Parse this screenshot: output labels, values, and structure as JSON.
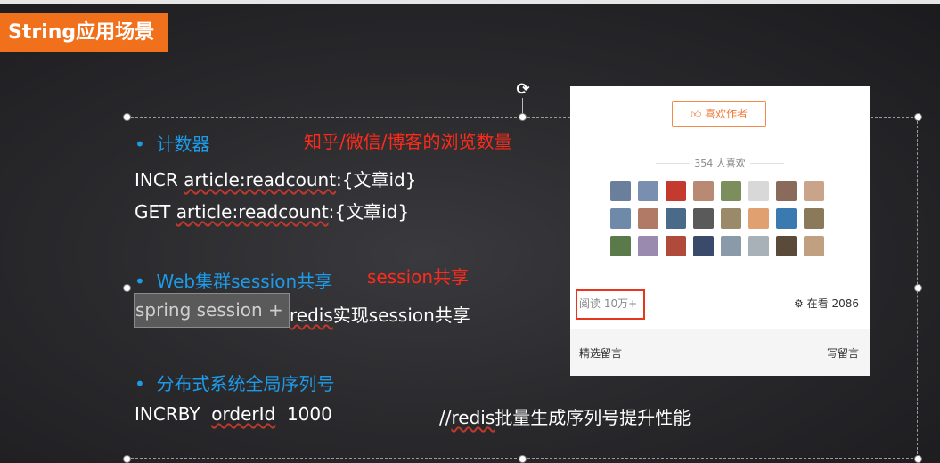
{
  "slide": {
    "title": "String应用场景",
    "rotate_icon": "rotate-icon"
  },
  "content": {
    "counter_heading": "计数器",
    "counter_note": "知乎/微信/博客的浏览数量",
    "incr_cmd": "INCR",
    "incr_key": "article:readcount",
    "incr_suffix": ":{文章id}",
    "get_cmd": "GET",
    "get_key": "article:readcount",
    "get_suffix": ":{文章id}",
    "web_heading": "Web集群session共享",
    "web_note": "session共享",
    "spring_text": "spring session + ",
    "redis_word": "redis",
    "redis_suffix": "实现session共享",
    "dist_heading": "分布式系统全局序列号",
    "incrby_cmd": "INCRBY",
    "incrby_key": "orderId",
    "incrby_val": "1000",
    "incrby_comment_prefix": "//",
    "incrby_comment_redis": "redis",
    "incrby_comment_rest": "批量生成序列号提升性能"
  },
  "card": {
    "like_button": "喜欢作者",
    "like_icon": "thumbs-up-icon",
    "likes_count": "354 人喜欢",
    "read_count": "阅读 10万+",
    "watching_icon": "watching-icon",
    "watching": "在看 2086",
    "selected_comments": "精选留言",
    "write_comment": "写留言",
    "avatar_colors": [
      "#6a7f9c",
      "#7a8fb0",
      "#c43a2e",
      "#b88a74",
      "#7c8e5c",
      "#d8d8d8",
      "#8a6a5a",
      "#c9a48a",
      "#6e8aa8",
      "#b07a66",
      "#4a6a8a",
      "#5a5a5a",
      "#9a8a6a",
      "#e0a070",
      "#3a7ab0",
      "#8a7a5a",
      "#5a7a4a",
      "#9a8ab0",
      "#b04a3a",
      "#3a4a6a",
      "#8a9aa8",
      "#a8b0b8",
      "#5a4a3a",
      "#c0a080"
    ]
  }
}
